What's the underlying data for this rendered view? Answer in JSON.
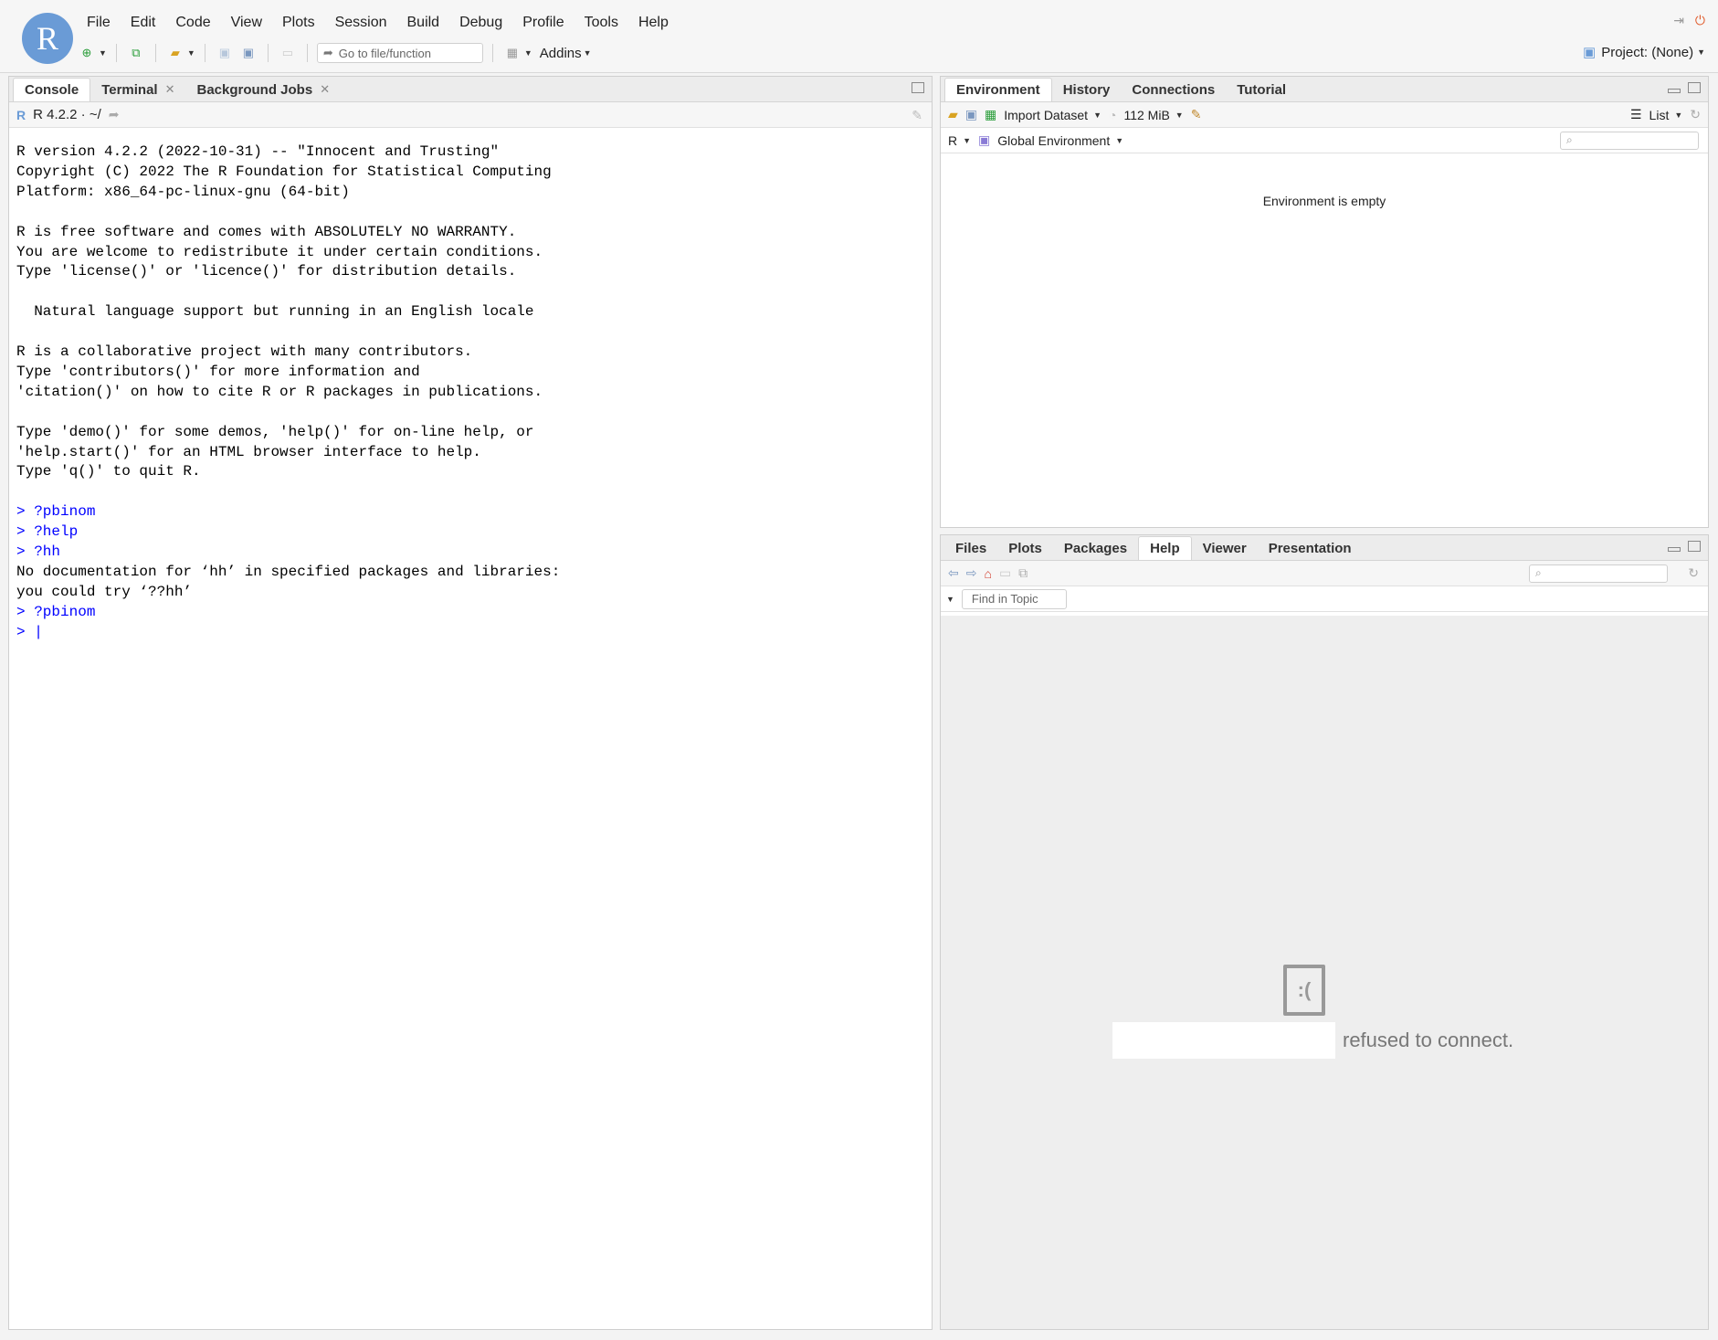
{
  "app": {
    "logo_letter": "R",
    "menu": [
      "File",
      "Edit",
      "Code",
      "View",
      "Plots",
      "Session",
      "Build",
      "Debug",
      "Profile",
      "Tools",
      "Help"
    ],
    "goto_placeholder": "Go to file/function",
    "addins_label": "Addins",
    "project_label": "Project: (None)"
  },
  "console": {
    "tabs": [
      "Console",
      "Terminal",
      "Background Jobs"
    ],
    "status": "R 4.2.2 · ~/",
    "lines": [
      {
        "text": "R version 4.2.2 (2022-10-31) -- \"Innocent and Trusting\"",
        "type": "out"
      },
      {
        "text": "Copyright (C) 2022 The R Foundation for Statistical Computing",
        "type": "out"
      },
      {
        "text": "Platform: x86_64-pc-linux-gnu (64-bit)",
        "type": "out"
      },
      {
        "text": "",
        "type": "out"
      },
      {
        "text": "R is free software and comes with ABSOLUTELY NO WARRANTY.",
        "type": "out"
      },
      {
        "text": "You are welcome to redistribute it under certain conditions.",
        "type": "out"
      },
      {
        "text": "Type 'license()' or 'licence()' for distribution details.",
        "type": "out"
      },
      {
        "text": "",
        "type": "out"
      },
      {
        "text": "  Natural language support but running in an English locale",
        "type": "out"
      },
      {
        "text": "",
        "type": "out"
      },
      {
        "text": "R is a collaborative project with many contributors.",
        "type": "out"
      },
      {
        "text": "Type 'contributors()' for more information and",
        "type": "out"
      },
      {
        "text": "'citation()' on how to cite R or R packages in publications.",
        "type": "out"
      },
      {
        "text": "",
        "type": "out"
      },
      {
        "text": "Type 'demo()' for some demos, 'help()' for on-line help, or",
        "type": "out"
      },
      {
        "text": "'help.start()' for an HTML browser interface to help.",
        "type": "out"
      },
      {
        "text": "Type 'q()' to quit R.",
        "type": "out"
      },
      {
        "text": "",
        "type": "out"
      },
      {
        "text": "> ?pbinom",
        "type": "cmd"
      },
      {
        "text": "> ?help",
        "type": "cmd"
      },
      {
        "text": "> ?hh",
        "type": "cmd"
      },
      {
        "text": "No documentation for ‘hh’ in specified packages and libraries:",
        "type": "out"
      },
      {
        "text": "you could try ‘??hh’",
        "type": "out"
      },
      {
        "text": "> ?pbinom",
        "type": "cmd"
      },
      {
        "text": "> |",
        "type": "cmd"
      }
    ]
  },
  "environment": {
    "tabs": [
      "Environment",
      "History",
      "Connections",
      "Tutorial"
    ],
    "import_label": "Import Dataset",
    "memory_label": "112 MiB",
    "view_label": "List",
    "lang_label": "R",
    "scope_label": "Global Environment",
    "empty_message": "Environment is empty"
  },
  "help": {
    "tabs": [
      "Files",
      "Plots",
      "Packages",
      "Help",
      "Viewer",
      "Presentation"
    ],
    "find_placeholder": "Find in Topic",
    "error_text": "refused to connect."
  }
}
